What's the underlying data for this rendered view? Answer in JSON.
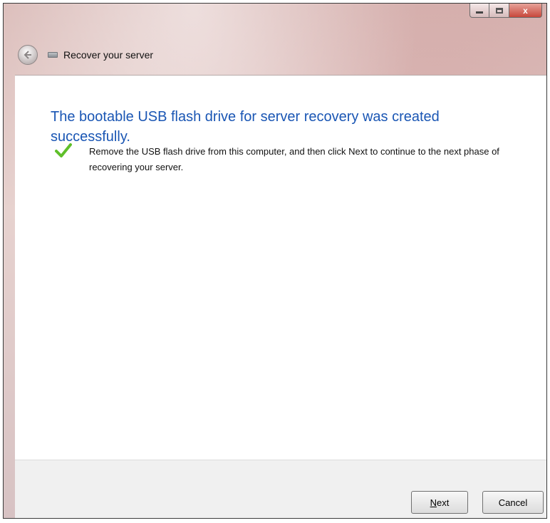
{
  "window": {
    "title": "Recover your server",
    "caption_buttons": {
      "close_glyph": "x"
    }
  },
  "content": {
    "heading": "The bootable USB flash drive for server recovery  was created successfully.",
    "status_icon": "checkmark-icon",
    "message": "Remove the USB flash drive from this computer, and then click Next to continue to the next phase of recovering your  server."
  },
  "footer": {
    "next_accel": "N",
    "next_rest": "ext",
    "cancel_label": "Cancel"
  },
  "colors": {
    "heading": "#1a56b4",
    "check": "#5fbf2a"
  }
}
